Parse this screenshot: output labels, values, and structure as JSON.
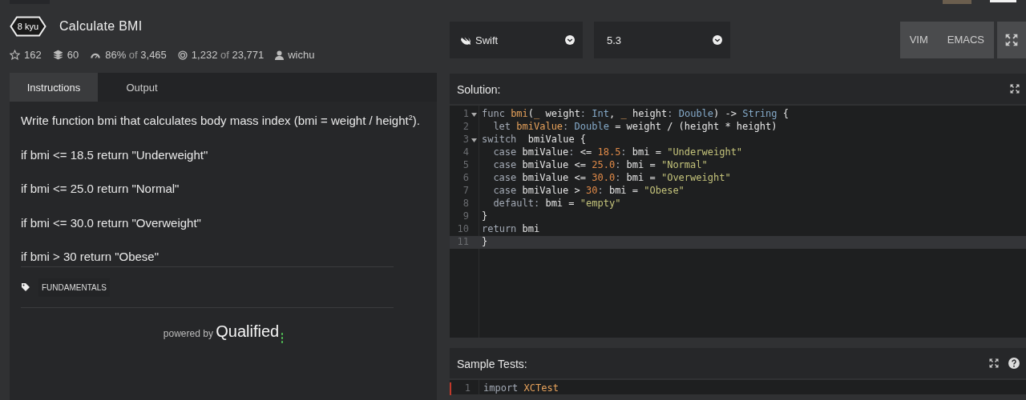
{
  "header": {
    "rank": "8 kyu",
    "title": "Calculate BMI",
    "stats": [
      {
        "kind": "stars",
        "value": "162"
      },
      {
        "kind": "collections",
        "value": "60"
      },
      {
        "kind": "satisfaction",
        "value": "86%",
        "of": "of",
        "total": "3,465"
      },
      {
        "kind": "completed",
        "value": "1,232",
        "of": "of",
        "total": "23,771"
      },
      {
        "kind": "author",
        "value": "wichu"
      }
    ]
  },
  "instructions": {
    "tabs": [
      {
        "label": "Instructions",
        "selected": true
      },
      {
        "label": "Output",
        "selected": false
      }
    ],
    "paragraphs": [
      "Write function bmi that calculates body mass index (bmi = weight / height$^{2}$).",
      "if bmi <= 18.5 return \"Underweight\"",
      "if bmi <= 25.0 return \"Normal\"",
      "if bmi <= 30.0 return \"Overweight\"",
      "if bmi > 30 return \"Obese\""
    ],
    "tags": [
      "FUNDAMENTALS"
    ],
    "powered_by": {
      "prefix": "powered by",
      "brand": "Qualified"
    }
  },
  "editor": {
    "language": "Swift",
    "version": "5.3",
    "modes": [
      "VIM",
      "EMACS"
    ]
  },
  "solution": {
    "title": "Solution:",
    "lines": [
      {
        "number": "1",
        "foldable": true,
        "active": false,
        "tokens": [
          {
            "kind": "kw",
            "text": "func "
          },
          {
            "kind": "fn",
            "text": "bmi"
          },
          {
            "kind": "plain",
            "text": "("
          },
          {
            "kind": "fn",
            "text": "_"
          },
          {
            "kind": "plain",
            "text": " weight"
          },
          {
            "kind": "kw",
            "text": ": "
          },
          {
            "kind": "type",
            "text": "Int"
          },
          {
            "kind": "plain",
            "text": ", "
          },
          {
            "kind": "fn",
            "text": "_"
          },
          {
            "kind": "plain",
            "text": " height"
          },
          {
            "kind": "kw",
            "text": ": "
          },
          {
            "kind": "type",
            "text": "Double"
          },
          {
            "kind": "plain",
            "text": ") -> "
          },
          {
            "kind": "type",
            "text": "String"
          },
          {
            "kind": "plain",
            "text": " {"
          }
        ]
      },
      {
        "number": "2",
        "foldable": false,
        "active": false,
        "indented": true,
        "tokens": [
          {
            "kind": "kw",
            "text": "let "
          },
          {
            "kind": "fn",
            "text": "bmiValue"
          },
          {
            "kind": "kw",
            "text": ": "
          },
          {
            "kind": "type",
            "text": "Double"
          },
          {
            "kind": "plain",
            "text": " = weight / (height * height)"
          }
        ]
      },
      {
        "number": "3",
        "foldable": true,
        "active": false,
        "tokens": [
          {
            "kind": "kw",
            "text": "switch"
          },
          {
            "kind": "plain",
            "text": "  bmiValue {"
          }
        ]
      },
      {
        "number": "4",
        "foldable": false,
        "active": false,
        "indented": true,
        "tokens": [
          {
            "kind": "kw",
            "text": "case "
          },
          {
            "kind": "plain",
            "text": "bmiValue"
          },
          {
            "kind": "kw",
            "text": ": "
          },
          {
            "kind": "plain",
            "text": "<= "
          },
          {
            "kind": "num",
            "text": "18.5"
          },
          {
            "kind": "kw",
            "text": ": "
          },
          {
            "kind": "plain",
            "text": "bmi = "
          },
          {
            "kind": "str",
            "text": "\"Underweight\""
          }
        ]
      },
      {
        "number": "5",
        "foldable": false,
        "active": false,
        "indented": true,
        "tokens": [
          {
            "kind": "kw",
            "text": "case "
          },
          {
            "kind": "plain",
            "text": "bmiValue <= "
          },
          {
            "kind": "num",
            "text": "25.0"
          },
          {
            "kind": "kw",
            "text": ": "
          },
          {
            "kind": "plain",
            "text": "bmi = "
          },
          {
            "kind": "str",
            "text": "\"Normal\""
          }
        ]
      },
      {
        "number": "6",
        "foldable": false,
        "active": false,
        "indented": true,
        "tokens": [
          {
            "kind": "kw",
            "text": "case "
          },
          {
            "kind": "plain",
            "text": "bmiValue <= "
          },
          {
            "kind": "num",
            "text": "30.0"
          },
          {
            "kind": "kw",
            "text": ": "
          },
          {
            "kind": "plain",
            "text": "bmi = "
          },
          {
            "kind": "str",
            "text": "\"Overweight\""
          }
        ]
      },
      {
        "number": "7",
        "foldable": false,
        "active": false,
        "indented": true,
        "tokens": [
          {
            "kind": "kw",
            "text": "case "
          },
          {
            "kind": "plain",
            "text": "bmiValue > "
          },
          {
            "kind": "num",
            "text": "30"
          },
          {
            "kind": "kw",
            "text": ": "
          },
          {
            "kind": "plain",
            "text": "bmi = "
          },
          {
            "kind": "str",
            "text": "\"Obese\""
          }
        ]
      },
      {
        "number": "8",
        "foldable": false,
        "active": false,
        "indented": true,
        "tokens": [
          {
            "kind": "kw",
            "text": "default"
          },
          {
            "kind": "kw",
            "text": ": "
          },
          {
            "kind": "plain",
            "text": "bmi = "
          },
          {
            "kind": "str",
            "text": "\"empty\""
          }
        ]
      },
      {
        "number": "9",
        "foldable": false,
        "active": false,
        "tokens": [
          {
            "kind": "plain",
            "text": "}"
          }
        ]
      },
      {
        "number": "10",
        "foldable": false,
        "active": false,
        "tokens": [
          {
            "kind": "kw",
            "text": "return "
          },
          {
            "kind": "plain",
            "text": "bmi"
          }
        ]
      },
      {
        "number": "11",
        "foldable": false,
        "active": true,
        "tokens": [
          {
            "kind": "plain",
            "text": "}"
          }
        ]
      }
    ]
  },
  "sample_tests": {
    "title": "Sample Tests:",
    "lines": [
      {
        "number": "1",
        "foldable": false,
        "active": false,
        "marked": true,
        "tokens": [
          {
            "kind": "kw",
            "text": "import "
          },
          {
            "kind": "fn",
            "text": "XCTest"
          }
        ]
      }
    ]
  }
}
